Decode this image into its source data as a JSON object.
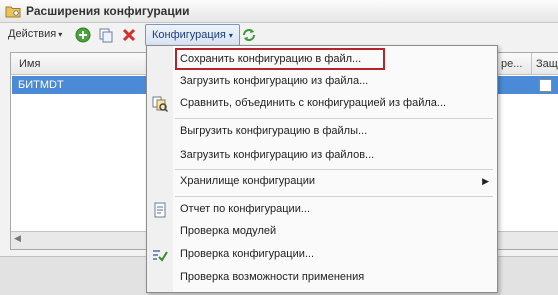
{
  "window": {
    "title": "Расширения конфигурации",
    "icon": "folder-config-icon"
  },
  "toolbar": {
    "actions_label": "Действия",
    "actions_arrow": "▾",
    "add_icon": "add-circle-icon",
    "copy_icon": "copy-icon",
    "delete_icon": "delete-x-icon",
    "config_label": "Конфигурация",
    "config_arrow": "▾",
    "refresh_icon": "refresh-icon"
  },
  "grid": {
    "columns": {
      "name": "Имя",
      "col_partial": "ре...",
      "col_protect": "Защ"
    },
    "rows": [
      {
        "name": "БИТМDT"
      }
    ],
    "scroll_left": "◀"
  },
  "menu": {
    "items": [
      {
        "label": "Сохранить конфигурацию в файл..."
      },
      {
        "label": "Загрузить конфигурацию из файла..."
      },
      {
        "label": "Сравнить, объединить с конфигурацией из файла...",
        "icon": "compare-merge-icon"
      },
      {
        "label": "Выгрузить конфигурацию в файлы..."
      },
      {
        "label": "Загрузить конфигурацию из файлов..."
      },
      {
        "label": "Хранилище конфигурации",
        "submenu_arrow": "▶"
      },
      {
        "label": "Отчет по конфигурации...",
        "icon": "report-icon"
      },
      {
        "label": "Проверка модулей"
      },
      {
        "label": "Проверка конфигурации...",
        "icon": "check-config-icon"
      },
      {
        "label": "Проверка возможности применения"
      }
    ]
  },
  "colors": {
    "selection": "#4a8ad6",
    "highlight_frame": "#b4252b",
    "config_button_text": "#1e3f7a"
  }
}
